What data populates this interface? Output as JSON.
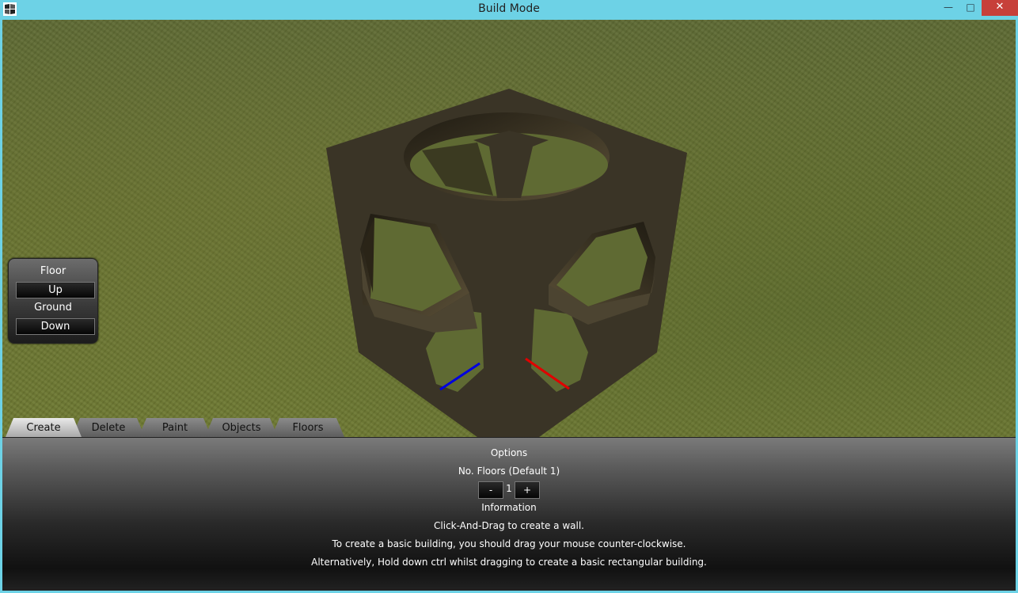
{
  "window": {
    "title": "Build Mode",
    "icon": "app-logo-icon",
    "controls": {
      "minimize": "—",
      "maximize": "□",
      "close": "✕"
    }
  },
  "floor_panel": {
    "title": "Floor",
    "up_label": "Up",
    "current_floor": "Ground",
    "down_label": "Down"
  },
  "tabs": [
    {
      "label": "Create",
      "active": true
    },
    {
      "label": "Delete",
      "active": false
    },
    {
      "label": "Paint",
      "active": false
    },
    {
      "label": "Objects",
      "active": false
    },
    {
      "label": "Floors",
      "active": false
    }
  ],
  "create_panel": {
    "options_title": "Options",
    "floors_label": "No. Floors (Default 1)",
    "minus_label": "-",
    "floor_count": "1",
    "plus_label": "+",
    "info_title": "Information",
    "info_lines": [
      "Click-And-Drag to create a wall.",
      "To create a basic building, you should drag your mouse counter-clockwise.",
      "Alternatively, Hold down ctrl whilst dragging to create a basic rectangular building."
    ]
  },
  "colors": {
    "titlebar": "#6dd2e6",
    "close_button": "#c7403a",
    "grass": "#66722f",
    "cube": "#3a3426",
    "axis_x": "#e00000",
    "axis_z": "#0000e0"
  }
}
